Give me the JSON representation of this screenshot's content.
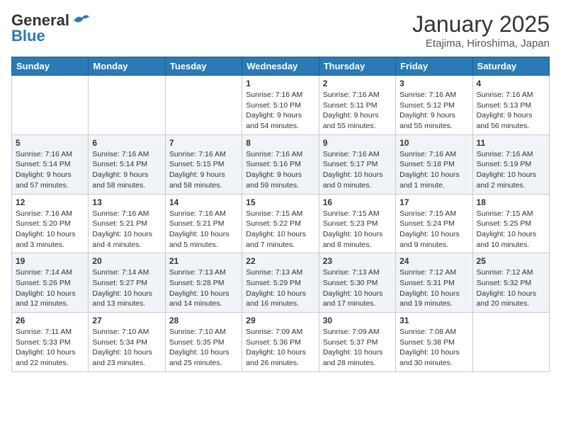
{
  "header": {
    "logo_general": "General",
    "logo_blue": "Blue",
    "title": "January 2025",
    "subtitle": "Etajima, Hiroshima, Japan"
  },
  "weekdays": [
    "Sunday",
    "Monday",
    "Tuesday",
    "Wednesday",
    "Thursday",
    "Friday",
    "Saturday"
  ],
  "weeks": [
    [
      {
        "day": "",
        "info": ""
      },
      {
        "day": "",
        "info": ""
      },
      {
        "day": "",
        "info": ""
      },
      {
        "day": "1",
        "info": "Sunrise: 7:16 AM\nSunset: 5:10 PM\nDaylight: 9 hours\nand 54 minutes."
      },
      {
        "day": "2",
        "info": "Sunrise: 7:16 AM\nSunset: 5:11 PM\nDaylight: 9 hours\nand 55 minutes."
      },
      {
        "day": "3",
        "info": "Sunrise: 7:16 AM\nSunset: 5:12 PM\nDaylight: 9 hours\nand 55 minutes."
      },
      {
        "day": "4",
        "info": "Sunrise: 7:16 AM\nSunset: 5:13 PM\nDaylight: 9 hours\nand 56 minutes."
      }
    ],
    [
      {
        "day": "5",
        "info": "Sunrise: 7:16 AM\nSunset: 5:14 PM\nDaylight: 9 hours\nand 57 minutes."
      },
      {
        "day": "6",
        "info": "Sunrise: 7:16 AM\nSunset: 5:14 PM\nDaylight: 9 hours\nand 58 minutes."
      },
      {
        "day": "7",
        "info": "Sunrise: 7:16 AM\nSunset: 5:15 PM\nDaylight: 9 hours\nand 58 minutes."
      },
      {
        "day": "8",
        "info": "Sunrise: 7:16 AM\nSunset: 5:16 PM\nDaylight: 9 hours\nand 59 minutes."
      },
      {
        "day": "9",
        "info": "Sunrise: 7:16 AM\nSunset: 5:17 PM\nDaylight: 10 hours\nand 0 minutes."
      },
      {
        "day": "10",
        "info": "Sunrise: 7:16 AM\nSunset: 5:18 PM\nDaylight: 10 hours\nand 1 minute."
      },
      {
        "day": "11",
        "info": "Sunrise: 7:16 AM\nSunset: 5:19 PM\nDaylight: 10 hours\nand 2 minutes."
      }
    ],
    [
      {
        "day": "12",
        "info": "Sunrise: 7:16 AM\nSunset: 5:20 PM\nDaylight: 10 hours\nand 3 minutes."
      },
      {
        "day": "13",
        "info": "Sunrise: 7:16 AM\nSunset: 5:21 PM\nDaylight: 10 hours\nand 4 minutes."
      },
      {
        "day": "14",
        "info": "Sunrise: 7:16 AM\nSunset: 5:21 PM\nDaylight: 10 hours\nand 5 minutes."
      },
      {
        "day": "15",
        "info": "Sunrise: 7:15 AM\nSunset: 5:22 PM\nDaylight: 10 hours\nand 7 minutes."
      },
      {
        "day": "16",
        "info": "Sunrise: 7:15 AM\nSunset: 5:23 PM\nDaylight: 10 hours\nand 8 minutes."
      },
      {
        "day": "17",
        "info": "Sunrise: 7:15 AM\nSunset: 5:24 PM\nDaylight: 10 hours\nand 9 minutes."
      },
      {
        "day": "18",
        "info": "Sunrise: 7:15 AM\nSunset: 5:25 PM\nDaylight: 10 hours\nand 10 minutes."
      }
    ],
    [
      {
        "day": "19",
        "info": "Sunrise: 7:14 AM\nSunset: 5:26 PM\nDaylight: 10 hours\nand 12 minutes."
      },
      {
        "day": "20",
        "info": "Sunrise: 7:14 AM\nSunset: 5:27 PM\nDaylight: 10 hours\nand 13 minutes."
      },
      {
        "day": "21",
        "info": "Sunrise: 7:13 AM\nSunset: 5:28 PM\nDaylight: 10 hours\nand 14 minutes."
      },
      {
        "day": "22",
        "info": "Sunrise: 7:13 AM\nSunset: 5:29 PM\nDaylight: 10 hours\nand 16 minutes."
      },
      {
        "day": "23",
        "info": "Sunrise: 7:13 AM\nSunset: 5:30 PM\nDaylight: 10 hours\nand 17 minutes."
      },
      {
        "day": "24",
        "info": "Sunrise: 7:12 AM\nSunset: 5:31 PM\nDaylight: 10 hours\nand 19 minutes."
      },
      {
        "day": "25",
        "info": "Sunrise: 7:12 AM\nSunset: 5:32 PM\nDaylight: 10 hours\nand 20 minutes."
      }
    ],
    [
      {
        "day": "26",
        "info": "Sunrise: 7:11 AM\nSunset: 5:33 PM\nDaylight: 10 hours\nand 22 minutes."
      },
      {
        "day": "27",
        "info": "Sunrise: 7:10 AM\nSunset: 5:34 PM\nDaylight: 10 hours\nand 23 minutes."
      },
      {
        "day": "28",
        "info": "Sunrise: 7:10 AM\nSunset: 5:35 PM\nDaylight: 10 hours\nand 25 minutes."
      },
      {
        "day": "29",
        "info": "Sunrise: 7:09 AM\nSunset: 5:36 PM\nDaylight: 10 hours\nand 26 minutes."
      },
      {
        "day": "30",
        "info": "Sunrise: 7:09 AM\nSunset: 5:37 PM\nDaylight: 10 hours\nand 28 minutes."
      },
      {
        "day": "31",
        "info": "Sunrise: 7:08 AM\nSunset: 5:38 PM\nDaylight: 10 hours\nand 30 minutes."
      },
      {
        "day": "",
        "info": ""
      }
    ]
  ]
}
